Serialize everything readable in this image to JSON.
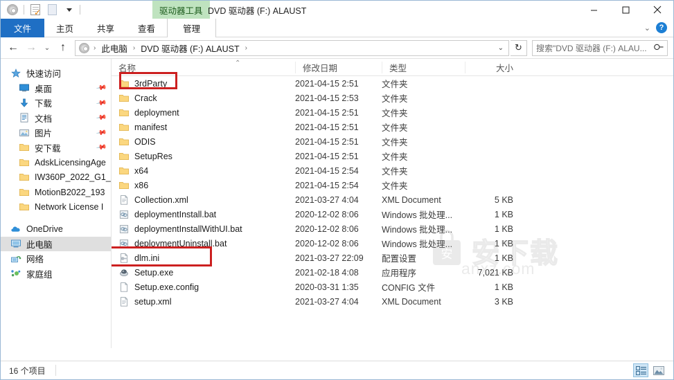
{
  "window": {
    "contextual_tab_group": "驱动器工具",
    "title": "DVD 驱动器 (F:) ALAUST",
    "minimize": "—",
    "maximize": "□",
    "close": "✕"
  },
  "quick_access_toolbar": {
    "items": [
      {
        "name": "drive-icon",
        "label": "驱动器"
      },
      {
        "name": "properties-icon",
        "label": "属性"
      },
      {
        "name": "new-folder-icon",
        "label": "新建文件夹"
      },
      {
        "name": "customize-dropdown",
        "label": "自定义快速访问工具栏"
      }
    ]
  },
  "ribbon": {
    "tabs": [
      {
        "label": "文件",
        "active": true
      },
      {
        "label": "主页",
        "active": false
      },
      {
        "label": "共享",
        "active": false
      },
      {
        "label": "查看",
        "active": false
      },
      {
        "label": "管理",
        "active": false,
        "contextual": true
      }
    ],
    "collapse_label": "⌄",
    "help_label": "?"
  },
  "navigation": {
    "back": "←",
    "forward": "→",
    "recent": "⌄",
    "up": "↑",
    "refresh": "↻",
    "dropdown": "⌄",
    "breadcrumb": [
      "此电脑",
      "DVD 驱动器 (F:) ALAUST"
    ],
    "breadcrumb_separator": "›"
  },
  "search": {
    "placeholder": "搜索\"DVD 驱动器 (F:) ALAU...",
    "icon": "search-icon"
  },
  "sidebar": {
    "groups": [
      {
        "name": "quick-access",
        "label": "快速访问",
        "icon": "star-icon",
        "items": [
          {
            "label": "桌面",
            "icon": "desktop-icon",
            "pinned": true
          },
          {
            "label": "下载",
            "icon": "download-icon",
            "pinned": true
          },
          {
            "label": "文档",
            "icon": "documents-icon",
            "pinned": true
          },
          {
            "label": "图片",
            "icon": "pictures-icon",
            "pinned": true
          },
          {
            "label": "安下载",
            "icon": "folder-icon",
            "pinned": true
          },
          {
            "label": "AdskLicensingAge",
            "icon": "folder-icon",
            "pinned": false
          },
          {
            "label": "IW360P_2022_G1_",
            "icon": "folder-icon",
            "pinned": false
          },
          {
            "label": "MotionB2022_193",
            "icon": "folder-icon",
            "pinned": false
          },
          {
            "label": "Network License I",
            "icon": "folder-icon",
            "pinned": false
          }
        ]
      },
      {
        "name": "roots",
        "items": [
          {
            "label": "OneDrive",
            "icon": "onedrive-icon",
            "selected": false
          },
          {
            "label": "此电脑",
            "icon": "this-pc-icon",
            "selected": true
          },
          {
            "label": "网络",
            "icon": "network-icon",
            "selected": false
          },
          {
            "label": "家庭组",
            "icon": "homegroup-icon",
            "selected": false
          }
        ]
      }
    ]
  },
  "file_list": {
    "columns": [
      {
        "key": "name",
        "label": "名称",
        "sorted": true,
        "sort_arrow": "⌃"
      },
      {
        "key": "date",
        "label": "修改日期"
      },
      {
        "key": "type",
        "label": "类型"
      },
      {
        "key": "size",
        "label": "大小"
      }
    ],
    "rows": [
      {
        "name": "3rdParty",
        "date": "2021-04-15 2:51",
        "type": "文件夹",
        "size": "",
        "icon": "folder-icon"
      },
      {
        "name": "Crack",
        "date": "2021-04-15 2:53",
        "type": "文件夹",
        "size": "",
        "icon": "folder-icon",
        "highlighted": true
      },
      {
        "name": "deployment",
        "date": "2021-04-15 2:51",
        "type": "文件夹",
        "size": "",
        "icon": "folder-icon"
      },
      {
        "name": "manifest",
        "date": "2021-04-15 2:51",
        "type": "文件夹",
        "size": "",
        "icon": "folder-icon"
      },
      {
        "name": "ODIS",
        "date": "2021-04-15 2:51",
        "type": "文件夹",
        "size": "",
        "icon": "folder-icon"
      },
      {
        "name": "SetupRes",
        "date": "2021-04-15 2:51",
        "type": "文件夹",
        "size": "",
        "icon": "folder-icon"
      },
      {
        "name": "x64",
        "date": "2021-04-15 2:54",
        "type": "文件夹",
        "size": "",
        "icon": "folder-icon"
      },
      {
        "name": "x86",
        "date": "2021-04-15 2:54",
        "type": "文件夹",
        "size": "",
        "icon": "folder-icon"
      },
      {
        "name": "Collection.xml",
        "date": "2021-03-27 4:04",
        "type": "XML Document",
        "size": "5 KB",
        "icon": "xml-file-icon"
      },
      {
        "name": "deploymentInstall.bat",
        "date": "2020-12-02 8:06",
        "type": "Windows 批处理...",
        "size": "1 KB",
        "icon": "bat-file-icon"
      },
      {
        "name": "deploymentInstallWithUI.bat",
        "date": "2020-12-02 8:06",
        "type": "Windows 批处理...",
        "size": "1 KB",
        "icon": "bat-file-icon"
      },
      {
        "name": "deploymentUninstall.bat",
        "date": "2020-12-02 8:06",
        "type": "Windows 批处理...",
        "size": "1 KB",
        "icon": "bat-file-icon"
      },
      {
        "name": "dlm.ini",
        "date": "2021-03-27 22:09",
        "type": "配置设置",
        "size": "1 KB",
        "icon": "ini-file-icon"
      },
      {
        "name": "Setup.exe",
        "date": "2021-02-18 4:08",
        "type": "应用程序",
        "size": "7,021 KB",
        "icon": "exe-file-icon",
        "highlighted": true
      },
      {
        "name": "Setup.exe.config",
        "date": "2020-03-31 1:35",
        "type": "CONFIG 文件",
        "size": "1 KB",
        "icon": "blank-file-icon"
      },
      {
        "name": "setup.xml",
        "date": "2021-03-27 4:04",
        "type": "XML Document",
        "size": "3 KB",
        "icon": "xml-file-icon"
      }
    ]
  },
  "status_bar": {
    "item_count": "16 个项目",
    "views": [
      {
        "name": "details-view-button",
        "active": true
      },
      {
        "name": "large-icons-view-button",
        "active": false
      }
    ]
  },
  "watermark": {
    "text": "安下载",
    "subtext": "anxz.com"
  },
  "colors": {
    "file_tab_blue": "#1f6fc4",
    "contextual_green": "#bfe3bf",
    "highlight_red": "#cc2020",
    "selection_gray": "#dfdfdf",
    "window_border": "#9ab8d4"
  }
}
